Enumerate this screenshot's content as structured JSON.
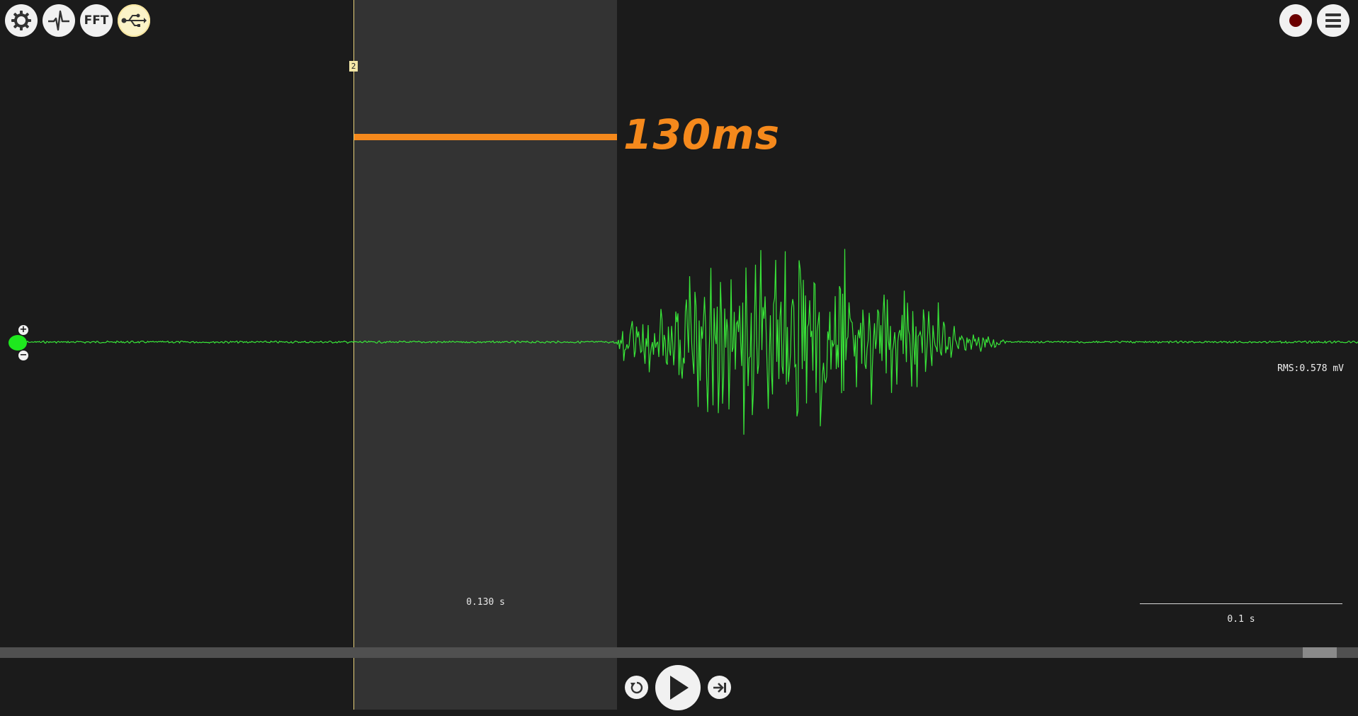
{
  "toolbar": {
    "settings_icon": "gear-icon",
    "signal_icon": "heartbeat-waveform-icon",
    "fft_label": "FFT",
    "usb_icon": "usb-icon"
  },
  "top_right": {
    "record_icon": "record-icon",
    "menu_icon": "hamburger-menu-icon"
  },
  "selection": {
    "marker_label": "2",
    "duration_label": "130ms",
    "time_label": "0.130 s"
  },
  "channel": {
    "color": "#39e639",
    "rms_label": "RMS:0.578 mV"
  },
  "timescale": {
    "label": "0.1 s"
  },
  "colors": {
    "background": "#1b1b1b",
    "selection": "#333333",
    "accent": "#f5891c",
    "signal": "#39e639"
  },
  "playback": {
    "rewind_icon": "rewind-icon",
    "play_icon": "play-icon",
    "skip_end_icon": "skip-to-end-icon"
  }
}
